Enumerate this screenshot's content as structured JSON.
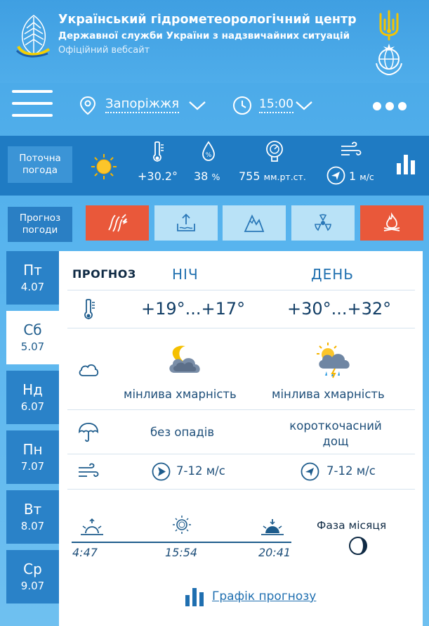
{
  "header": {
    "title": "Український гідрометеорологічний центр",
    "subtitle": "Державної служби України з надзвичайних ситуацій",
    "site_label": "Офіційний вебсайт"
  },
  "nav": {
    "city": "Запоріжжя",
    "time": "15:00"
  },
  "current": {
    "label_line1": "Поточна",
    "label_line2": "погода",
    "temperature": "+30.2°",
    "humidity_value": "38",
    "humidity_unit": "%",
    "pressure_value": "755",
    "pressure_unit": "мм.рт.ст.",
    "wind_value": "1",
    "wind_unit": "м/с"
  },
  "forecast_types": {
    "label_line1": "Прогноз",
    "label_line2": "погоди",
    "buttons": [
      {
        "icon": "storm-icon",
        "color": "#e9583a"
      },
      {
        "icon": "water-level-icon",
        "color": "#b9e2f7"
      },
      {
        "icon": "mountain-icon",
        "color": "#b9e2f7"
      },
      {
        "icon": "radiation-icon",
        "color": "#b9e2f7"
      },
      {
        "icon": "fire-icon",
        "color": "#e9583a"
      }
    ]
  },
  "days": [
    {
      "name": "Пт",
      "date": "4.07"
    },
    {
      "name": "Сб",
      "date": "5.07"
    },
    {
      "name": "Нд",
      "date": "6.07"
    },
    {
      "name": "Пн",
      "date": "7.07"
    },
    {
      "name": "Вт",
      "date": "8.07"
    },
    {
      "name": "Ср",
      "date": "9.07"
    }
  ],
  "active_day": 1,
  "forecast": {
    "heading": "ПРОГНОЗ",
    "night_label": "НІЧ",
    "day_label": "ДЕНЬ",
    "night_temp": "+19°...+17°",
    "day_temp": "+30°...+32°",
    "night_cloud": "мінлива хмарність",
    "day_cloud": "мінлива хмарність",
    "night_precip": "без опадів",
    "day_precip_line1": "короткочасний",
    "day_precip_line2": "дощ",
    "night_wind": "7-12 м/с",
    "day_wind": "7-12 м/с"
  },
  "sun": {
    "sunrise": "4:47",
    "noon": "15:54",
    "sunset": "20:41",
    "moon_label": "Фаза місяця"
  },
  "graph_link": "Графік прогнозу",
  "colors": {
    "accent_red": "#e9583a",
    "band_blue": "#1f7bc3",
    "text_blue": "#1e5c8c"
  }
}
